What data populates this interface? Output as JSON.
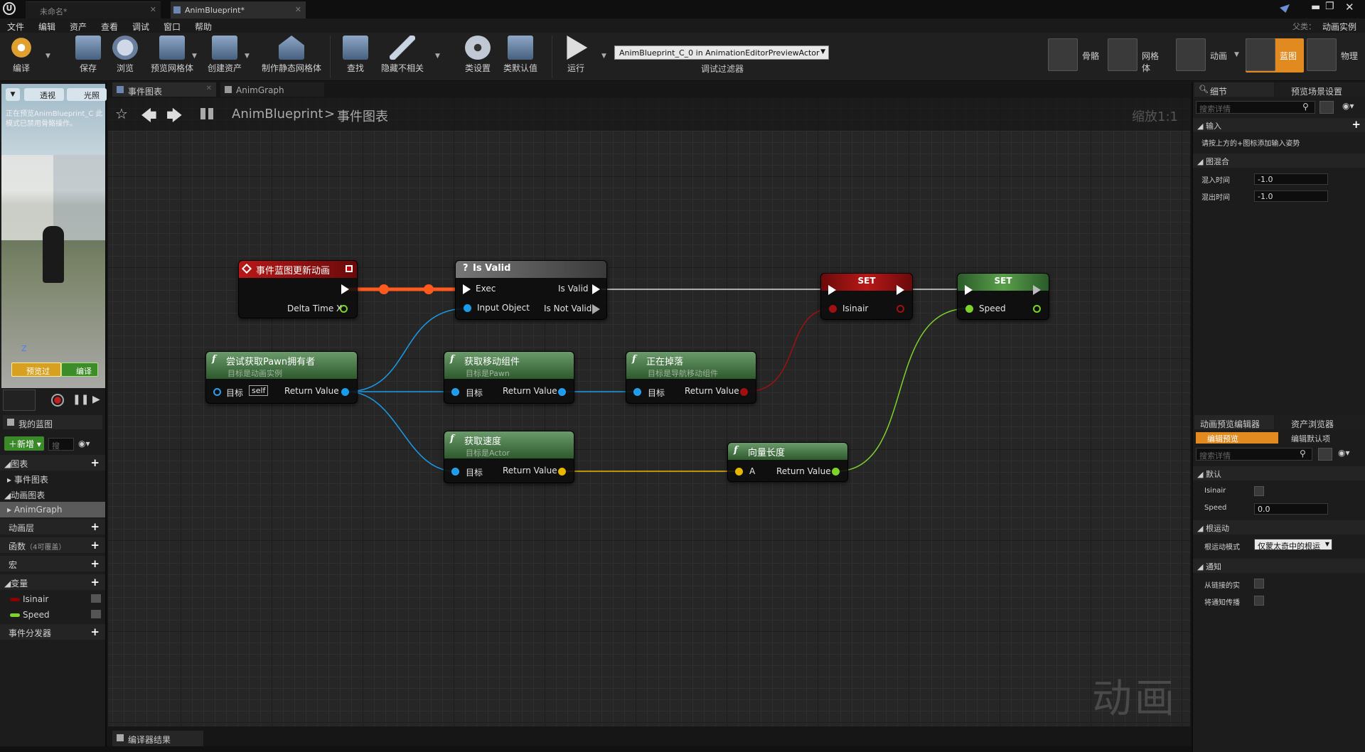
{
  "tabs": [
    {
      "label": "未命名*"
    },
    {
      "label": "AnimBlueprint*"
    }
  ],
  "parent_class": {
    "label": "父类：",
    "value": "动画实例"
  },
  "menu": [
    "文件",
    "编辑",
    "资产",
    "查看",
    "调试",
    "窗口",
    "帮助"
  ],
  "toolbar": {
    "compile": "编译",
    "save": "保存",
    "browse": "浏览",
    "preview_mesh": "预览网格体",
    "create_asset": "创建资产",
    "make_static_mesh": "制作静态网格体",
    "find": "查找",
    "hide_unrelated": "隐藏不相关",
    "class_settings": "类设置",
    "class_defaults": "类默认值",
    "play": "运行",
    "debug_object": "AnimBlueprint_C_0 in AnimationEditorPreviewActor",
    "debug_filter": "调试过滤器"
  },
  "modes": {
    "skeleton": "骨骼",
    "mesh": "网格体",
    "animation": "动画",
    "blueprint": "蓝图",
    "physics": "物理"
  },
  "viewport": {
    "perspective": "透视",
    "lit": "光照",
    "notice": "正在预览AnimBlueprint_C 此模式已禁用骨骼操作。",
    "preview_btn": "预览过",
    "compile_btn": "编译"
  },
  "my_blueprint": {
    "tab": "我的蓝图",
    "add": "新增",
    "search": "搜",
    "graphs": "图表",
    "event_graph": "事件图表",
    "anim_graphs": "动画图表",
    "anim_graph": "AnimGraph",
    "anim_layers": "动画层",
    "functions": "函数",
    "functions_count": "（4可覆盖）",
    "macros": "宏",
    "variables": "变量",
    "vars": [
      {
        "name": "Isinair",
        "color": "#8b0000"
      },
      {
        "name": "Speed",
        "color": "#7cd42a"
      }
    ],
    "dispatchers": "事件分发器"
  },
  "graph_tabs": [
    {
      "label": "事件图表"
    },
    {
      "label": "AnimGraph"
    }
  ],
  "breadcrumb": {
    "root": "AnimBlueprint",
    "sep": ">",
    "current": "事件图表",
    "zoom": "缩放1:1"
  },
  "watermark": "动画",
  "nodes": {
    "event": {
      "title": "事件蓝图更新动画",
      "pin": "Delta Time X"
    },
    "isvalid": {
      "title": "Is Valid",
      "exec": "Exec",
      "input": "Input Object",
      "valid": "Is Valid",
      "not_valid": "Is Not Valid"
    },
    "set1": {
      "title": "SET",
      "pin": "Isinair"
    },
    "set2": {
      "title": "SET",
      "pin": "Speed"
    },
    "pawn": {
      "title": "尝试获取Pawn拥有者",
      "sub": "目标是动画实例",
      "target": "目标",
      "self": "self",
      "ret": "Return Value"
    },
    "move": {
      "title": "获取移动组件",
      "sub": "目标是Pawn",
      "target": "目标",
      "ret": "Return Value"
    },
    "falling": {
      "title": "正在掉落",
      "sub": "目标是导航移动组件",
      "target": "目标",
      "ret": "Return Value"
    },
    "velocity": {
      "title": "获取速度",
      "sub": "目标是Actor",
      "target": "目标",
      "ret": "Return Value"
    },
    "vlen": {
      "title": "向量长度",
      "a": "A",
      "ret": "Return Value"
    }
  },
  "details": {
    "tab1": "细节",
    "tab2": "预览场景设置",
    "search": "搜索详情",
    "inputs": "输入",
    "inputs_hint": "请按上方的+图标添加输入姿势",
    "blend": "图混合",
    "blend_in": "混入时间",
    "blend_in_val": "-1.0",
    "blend_out": "混出时间",
    "blend_out_val": "-1.0"
  },
  "preview_editor": {
    "tab1": "动画预览编辑器",
    "tab2": "资产浏览器",
    "edit_preview": "编辑预览",
    "edit_defaults": "编辑默认项",
    "search": "搜索详情",
    "default": "默认",
    "isinair": "Isinair",
    "speed": "Speed",
    "speed_val": "0.0",
    "root_motion": "根运动",
    "root_motion_mode": "根运动模式",
    "root_motion_val": "仅蒙太奇中的根运",
    "notify": "通知",
    "from_linked": "从链接的实",
    "notify_propagate": "将通知传播"
  },
  "compiler_results": "编译器结果"
}
